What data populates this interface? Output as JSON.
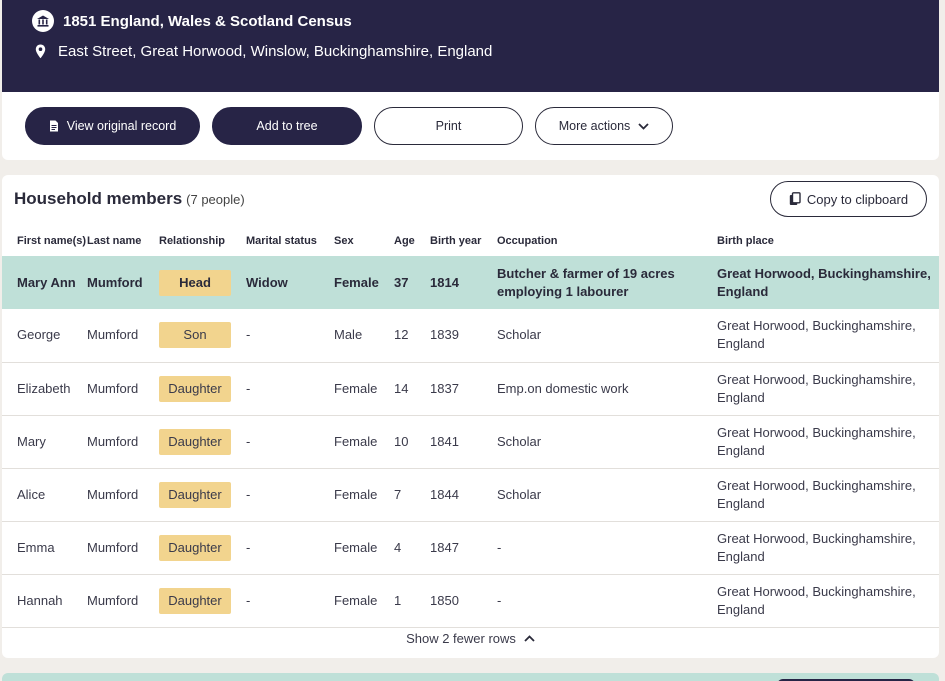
{
  "header": {
    "census_title": "1851 England, Wales & Scotland Census",
    "location": "East Street, Great Horwood, Winslow, Buckinghamshire, England"
  },
  "actions": {
    "view_original": "View original record",
    "add_to_tree": "Add to tree",
    "print": "Print",
    "more_actions": "More actions"
  },
  "household": {
    "title": "Household members",
    "count": "(7 people)",
    "copy_label": "Copy to clipboard",
    "columns": [
      "First name(s)",
      "Last name",
      "Relationship",
      "Marital status",
      "Sex",
      "Age",
      "Birth year",
      "Occupation",
      "Birth place"
    ],
    "rows": [
      {
        "first": "Mary Ann",
        "last": "Mumford",
        "relationship": "Head",
        "marital": "Widow",
        "sex": "Female",
        "age": "37",
        "birth_year": "1814",
        "occupation": "Butcher & farmer of 19 acres employing 1 labourer",
        "birth_place": "Great Horwood, Buckinghamshire, England"
      },
      {
        "first": "George",
        "last": "Mumford",
        "relationship": "Son",
        "marital": "-",
        "sex": "Male",
        "age": "12",
        "birth_year": "1839",
        "occupation": "Scholar",
        "birth_place": "Great Horwood, Buckinghamshire, England"
      },
      {
        "first": "Elizabeth",
        "last": "Mumford",
        "relationship": "Daughter",
        "marital": "-",
        "sex": "Female",
        "age": "14",
        "birth_year": "1837",
        "occupation": "Emp.on domestic work",
        "birth_place": "Great Horwood, Buckinghamshire, England"
      },
      {
        "first": "Mary",
        "last": "Mumford",
        "relationship": "Daughter",
        "marital": "-",
        "sex": "Female",
        "age": "10",
        "birth_year": "1841",
        "occupation": "Scholar",
        "birth_place": "Great Horwood, Buckinghamshire, England"
      },
      {
        "first": "Alice",
        "last": "Mumford",
        "relationship": "Daughter",
        "marital": "-",
        "sex": "Female",
        "age": "7",
        "birth_year": "1844",
        "occupation": "Scholar",
        "birth_place": "Great Horwood, Buckinghamshire, England"
      },
      {
        "first": "Emma",
        "last": "Mumford",
        "relationship": "Daughter",
        "marital": "-",
        "sex": "Female",
        "age": "4",
        "birth_year": "1847",
        "occupation": "-",
        "birth_place": "Great Horwood, Buckinghamshire, England"
      },
      {
        "first": "Hannah",
        "last": "Mumford",
        "relationship": "Daughter",
        "marital": "-",
        "sex": "Female",
        "age": "1",
        "birth_year": "1850",
        "occupation": "-",
        "birth_place": "Great Horwood, Buckinghamshire, England"
      }
    ],
    "show_fewer": "Show 2 fewer rows"
  },
  "icons": {
    "census": "census-building-icon",
    "location": "location-pin-icon",
    "document": "document-icon",
    "chevron_down": "chevron-down-icon",
    "copy": "copy-icon",
    "chevron_up": "chevron-up-icon"
  },
  "colors": {
    "header_bg": "#272446",
    "highlight_row": "#bfe0d8",
    "relationship_badge": "#f2d48e"
  }
}
